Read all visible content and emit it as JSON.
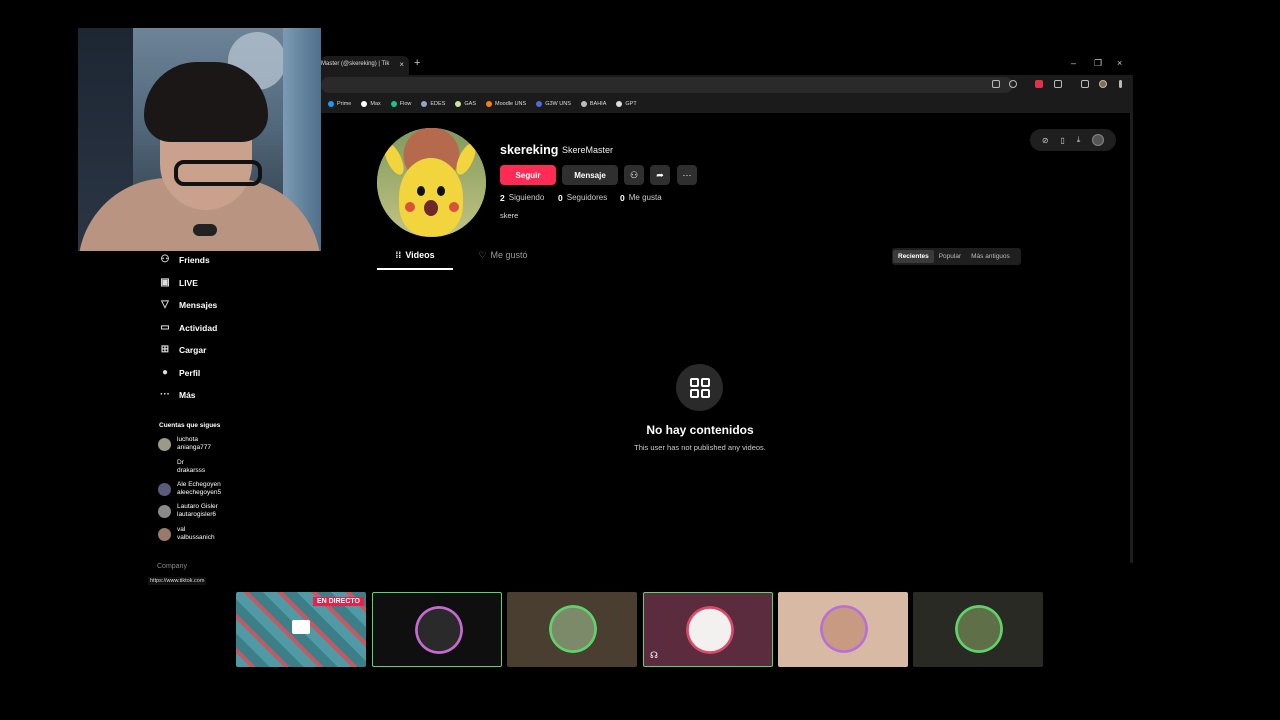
{
  "browser": {
    "tab_title": "Master (@skereking) | Tik",
    "tab_close": "×",
    "new_tab": "+",
    "window_min": "–",
    "window_max": "❐",
    "window_close": "×",
    "bookmarks": [
      {
        "label": "Prime",
        "color": "#1a98ff"
      },
      {
        "label": "Max",
        "color": "#ffffff"
      },
      {
        "label": "Flow",
        "color": "#12c98a"
      },
      {
        "label": "EDES",
        "color": "#8fa6c9"
      },
      {
        "label": "GAS",
        "color": "#c6e3a0"
      },
      {
        "label": "Moodle UNS",
        "color": "#f98012"
      },
      {
        "label": "G3W UNS",
        "color": "#4f6ad9"
      },
      {
        "label": "BAHIA",
        "color": "#bbbbbb"
      },
      {
        "label": "GPT",
        "color": "#dddddd"
      }
    ]
  },
  "sidebar": {
    "nav": [
      {
        "label": "Friends",
        "icon": "friends-icon",
        "glyph": "⚇"
      },
      {
        "label": "LIVE",
        "icon": "live-icon",
        "glyph": "▣"
      },
      {
        "label": "Mensajes",
        "icon": "messages-icon",
        "glyph": "▽"
      },
      {
        "label": "Actividad",
        "icon": "activity-icon",
        "glyph": "▭"
      },
      {
        "label": "Cargar",
        "icon": "upload-icon",
        "glyph": "⊞"
      },
      {
        "label": "Perfil",
        "icon": "profile-icon",
        "glyph": "●"
      },
      {
        "label": "Más",
        "icon": "more-icon",
        "glyph": "···"
      }
    ],
    "following_title": "Cuentas que sigues",
    "accounts": [
      {
        "name": "luchota",
        "handle": "anianga777"
      },
      {
        "name": "Dr",
        "handle": "drakarsss"
      },
      {
        "name": "Ale Echegoyen",
        "handle": "aleechegoyen5"
      },
      {
        "name": "Lautaro Gisler",
        "handle": "lautarogisler6"
      },
      {
        "name": "val",
        "handle": "valbussanich"
      }
    ],
    "company": "Company",
    "status_url": "https://www.tiktok.com"
  },
  "profile": {
    "username": "skereking",
    "nickname": "SkereMaster",
    "follow_label": "Seguir",
    "message_label": "Mensaje",
    "following_count": "2",
    "following_label": "Siguiendo",
    "followers_count": "0",
    "followers_label": "Seguidores",
    "likes_count": "0",
    "likes_label": "Me gusta",
    "bio": "skere",
    "accent": "#fe2c55"
  },
  "content_tabs": {
    "videos": "Videos",
    "liked": "Me gustó",
    "sort": [
      "Recientes",
      "Popular",
      "Más antiguos"
    ]
  },
  "empty_state": {
    "title": "No hay contenidos",
    "subtitle": "This user has not published any videos."
  },
  "stream_overlay": {
    "live_badge": "EN DIRECTO"
  }
}
